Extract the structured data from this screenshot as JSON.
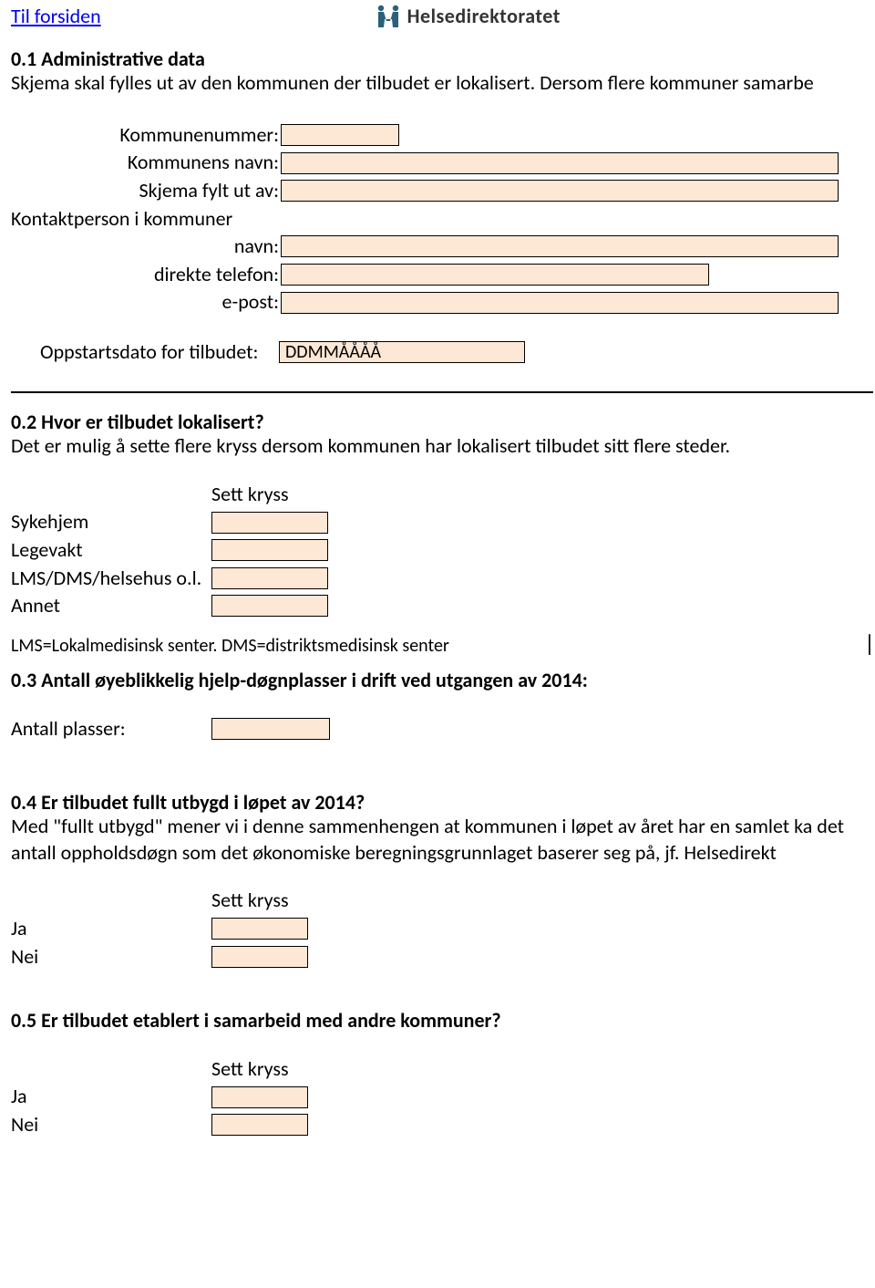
{
  "header": {
    "frontpage_link": "Til forsiden",
    "logo_text": "Helsedirektoratet"
  },
  "q01": {
    "title": "0.1 Administrative data",
    "subtitle": "Skjema skal fylles ut av den kommunen der tilbudet er lokalisert. Dersom flere kommuner samarbe",
    "fields": {
      "kommunenummer_label": "Kommunenummer:",
      "kommunens_navn_label": "Kommunens navn:",
      "skjema_fylt_ut_av_label": "Skjema fylt ut av:",
      "kontaktperson_heading": "Kontaktperson i kommuner",
      "navn_label": "navn:",
      "direkte_telefon_label": "direkte telefon:",
      "epost_label": "e-post:",
      "oppstartsdato_label": "Oppstartsdato for tilbudet:",
      "date_placeholder": "DDMMÅÅÅÅ",
      "kommunenummer": "",
      "kommunens_navn": "",
      "skjema_fylt_ut_av": "",
      "kontakt_navn": "",
      "kontakt_telefon": "",
      "kontakt_epost": "",
      "oppstartsdato": "DDMMÅÅÅÅ"
    }
  },
  "q02": {
    "title": "0.2 Hvor er tilbudet lokalisert?",
    "subtitle": "Det er mulig å sette flere kryss dersom kommunen har lokalisert tilbudet sitt flere steder.",
    "column_header": "Sett kryss",
    "options": [
      {
        "label": "Sykehjem",
        "value": ""
      },
      {
        "label": "Legevakt",
        "value": ""
      },
      {
        "label": "LMS/DMS/helsehus o.l.",
        "value": ""
      },
      {
        "label": "Annet",
        "value": ""
      }
    ],
    "note": "LMS=Lokalmedisinsk senter. DMS=distriktsmedisinsk senter"
  },
  "q03": {
    "title": "0.3 Antall øyeblikkelig hjelp-døgnplasser i drift ved utgangen av 2014:",
    "label": "Antall plasser:",
    "value": ""
  },
  "q04": {
    "title": "0.4 Er tilbudet fullt utbygd i løpet av 2014?",
    "subtitle": "Med \"fullt utbygd\" mener vi i denne sammenhengen at kommunen i løpet av året har en samlet ka det antall oppholdsdøgn som det økonomiske beregningsgrunnlaget baserer seg på, jf. Helsedirekt",
    "column_header": "Sett kryss",
    "options": [
      {
        "label": "Ja",
        "value": ""
      },
      {
        "label": "Nei",
        "value": ""
      }
    ]
  },
  "q05": {
    "title": "0.5 Er tilbudet etablert i samarbeid med andre kommuner?",
    "column_header": "Sett kryss",
    "options": [
      {
        "label": "Ja",
        "value": ""
      },
      {
        "label": "Nei",
        "value": ""
      }
    ]
  }
}
